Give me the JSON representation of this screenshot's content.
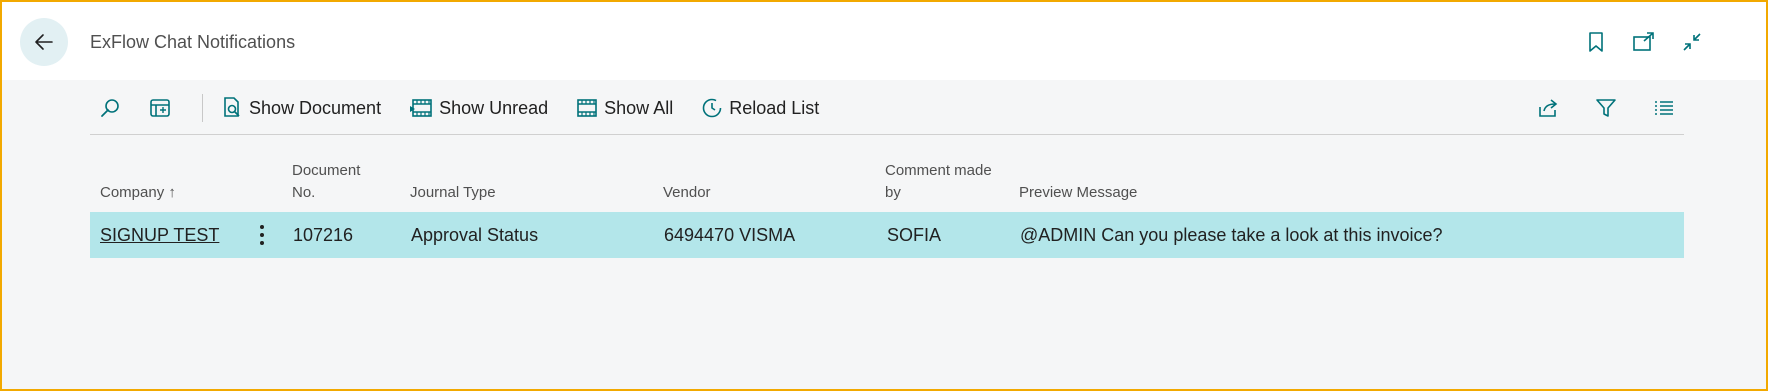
{
  "header": {
    "title": "ExFlow Chat Notifications",
    "back_icon": "arrow-left-icon",
    "icons": [
      "bookmark-icon",
      "open-in-new-window-icon",
      "collapse-icon"
    ]
  },
  "toolbar": {
    "search_icon": "search-icon",
    "layout_icon": "layout-toggle-icon",
    "actions": [
      {
        "label": "Show Document",
        "icon": "document-search-icon"
      },
      {
        "label": "Show Unread",
        "icon": "filter-list-icon"
      },
      {
        "label": "Show All",
        "icon": "list-all-icon"
      },
      {
        "label": "Reload List",
        "icon": "reload-icon"
      }
    ],
    "right_icons": [
      "share-icon",
      "filter-icon",
      "list-view-icon"
    ]
  },
  "grid": {
    "columns": {
      "company": "Company",
      "company_sort": "↑",
      "document_no_line1": "Document",
      "document_no_line2": "No.",
      "journal_type": "Journal Type",
      "vendor": "Vendor",
      "comment_by_line1": "Comment made",
      "comment_by_line2": "by",
      "preview_message": "Preview Message"
    },
    "rows": [
      {
        "company": "SIGNUP TEST",
        "document_no": "107216",
        "journal_type": "Approval Status",
        "vendor": "6494470 VISMA",
        "comment_by": "SOFIA",
        "preview_message": "@ADMIN Can you please take a look at this invoice?"
      }
    ]
  },
  "colors": {
    "accent": "#00727a",
    "selected_row": "#b3e6ea",
    "frame_border": "#f2a900",
    "page_background": "#f5f6f7"
  }
}
